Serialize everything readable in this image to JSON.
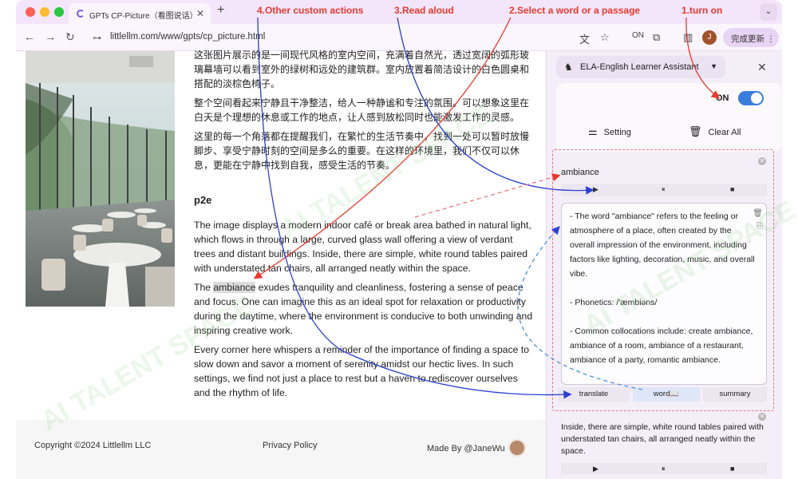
{
  "browser": {
    "tab_title": "GPTs CP-Picture（看图说话）",
    "new_tab_icon": "plus-icon",
    "url_prefix": "⊶",
    "url": "littlellm.com/www/gpts/cp_picture.html",
    "profile_initial": "J",
    "update_label": "完成更新 ⋮"
  },
  "annotations": {
    "a4": "4.Other custom actions",
    "a3": "3.Read aloud",
    "a2": "2.Select a word or a passage",
    "a1": "1.turn on"
  },
  "article": {
    "zh_p1": "这张图片展示的是一间现代风格的室内空间，充满着自然光，透过宽阔的弧形玻璃幕墙可以看到室外的绿树和远处的建筑群。室内放置着简洁设计的白色圆桌和搭配的淡棕色椅子。",
    "zh_p2": "整个空间看起来宁静且干净整洁，给人一种静谧和专注的氛围。可以想象这里在白天是个理想的休息或工作的地点，让人感到放松同时也能激发工作的灵感。",
    "zh_p3": "这里的每一个角落都在提醒我们，在繁忙的生活节奏中，找到一处可以暂时放慢脚步、享受宁静时刻的空间是多么的重要。在这样的环境里，我们不仅可以休息，更能在宁静中找到自我，感受生活的节奏。",
    "heading": "p2e",
    "en_p1": "The image displays a modern indoor café or break area bathed in natural light, which flows in through a large, curved glass wall offering a view of verdant trees and distant buildings. Inside, there are simple, white round tables paired with understated tan chairs, all arranged neatly within the space.",
    "en_p2_highlight": "ambiance",
    "en_p2_lead": "The ",
    "en_p2_rest": " exudes tranquility and cleanliness, fostering a sense of peace and focus. One can imagine this as an ideal spot for relaxation or productivity during the daytime, where the environment is conducive to both unwinding and inspiring creative work.",
    "en_p3": "Every corner here whispers a reminder of the importance of finding a space to slow down and savor a moment of serenity amidst our hectic lives. In such settings, we find not just a place to rest but a haven to rediscover ourselves and the rhythm of life."
  },
  "footer": {
    "copyright": "Copyright ©2024 Littlellm LLC",
    "privacy": "Privacy Policy",
    "made_by": "Made By @JaneWu"
  },
  "panel": {
    "title": "ELA-English Learner Assistant",
    "on_label": "ON",
    "setting_label": "Setting",
    "clear_label": "Clear All",
    "selected_word": "ambiance",
    "definition": [
      "- The word \"ambiance\" refers to the feeling or atmosphere of a place, often created by the overall impression of the environment, including factors like lighting, decoration, music, and overall vibe.",
      "",
      "- Phonetics: /'æmbiəns/",
      "",
      "- Common collocations include: create ambiance, ambiance of a room, ambiance of a restaurant, ambiance of a party, romantic ambiance."
    ],
    "modes": [
      "translate",
      "word📖",
      "summary"
    ],
    "second_selection": "Inside, there are simple, white round tables paired with understated tan chairs, all arranged neatly within the space."
  },
  "watermark": "AI TALENT SPACE",
  "colors": {
    "annotation": "#e8392e",
    "arrow_blue": "#2a3fd0",
    "toggle": "#3b7ddd"
  }
}
